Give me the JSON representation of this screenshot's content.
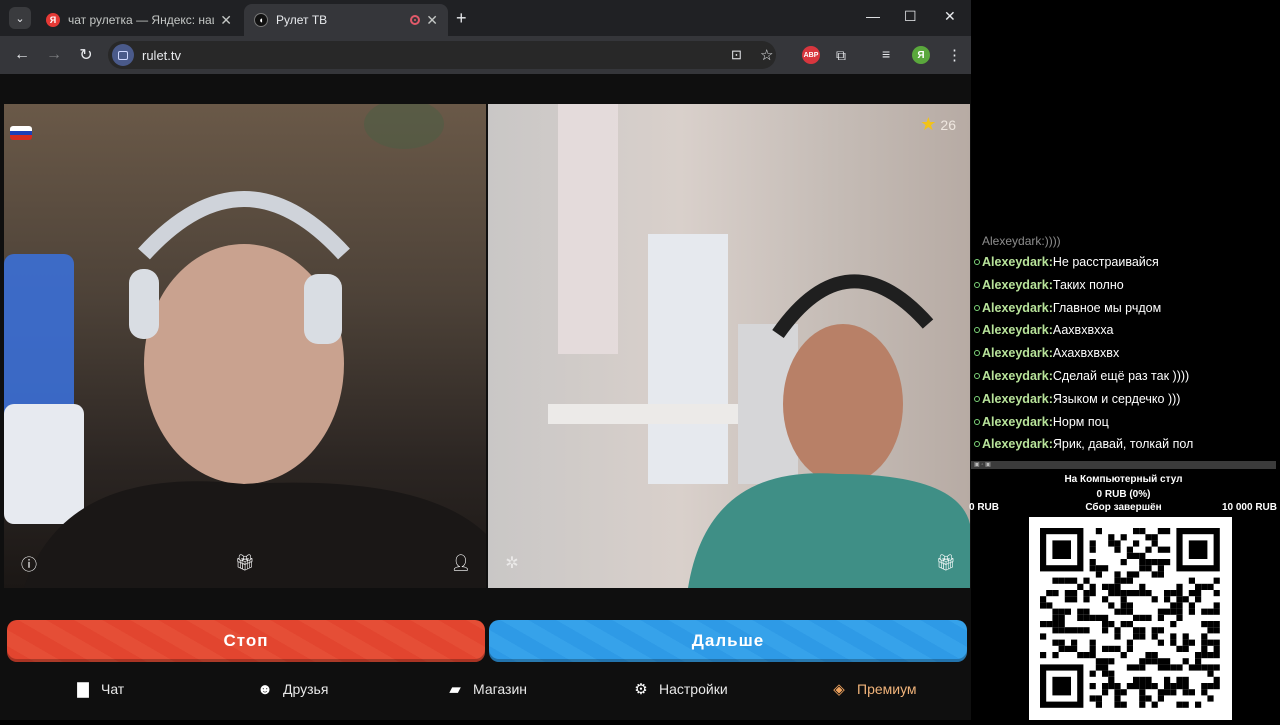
{
  "browser": {
    "tab_menu_icon": "chevron-down-icon",
    "tabs": [
      {
        "title": "чат рулетка — Яндекс: нашлось",
        "favicon": "yandex-icon",
        "favicon_letter": "Я",
        "favicon_color": "#e53935",
        "close": "✕"
      },
      {
        "title": "Рулет ТВ",
        "favicon": "rulet-icon",
        "favicon_color": "#111111",
        "close": "✕",
        "active": true
      }
    ],
    "new_tab": "+",
    "window_controls": {
      "minimize": "—",
      "maximize": "☐",
      "close": "✕"
    },
    "url": "rulet.tv",
    "nav": {
      "back": "←",
      "forward": "→",
      "reload": "↻"
    },
    "toolbar_icons": {
      "install": "⊡",
      "bookmark": "☆",
      "abp": "ABP",
      "extensions": "⧉",
      "media": "≡",
      "profile": "Я",
      "menu": "⋮"
    }
  },
  "video": {
    "stars_count": "26",
    "flag_colors": [
      "#ffffff",
      "#1c3fb8",
      "#d52b1e"
    ]
  },
  "buttons": {
    "stop_label": "Стоп",
    "next_label": "Дальше"
  },
  "bottom_nav": [
    {
      "label": "Чат",
      "icon": "chat-icon"
    },
    {
      "label": "Друзья",
      "icon": "friends-icon"
    },
    {
      "label": "Магазин",
      "icon": "shop-icon"
    },
    {
      "label": "Настройки",
      "icon": "settings-icon"
    },
    {
      "label": "Премиум",
      "icon": "premium-icon"
    }
  ],
  "stream_chat": {
    "cut_line": "Alexeydark:))))",
    "messages": [
      {
        "user": "Alexeydark:",
        "text": "Не расстраивайся"
      },
      {
        "user": "Alexeydark:",
        "text": "Таких полно"
      },
      {
        "user": "Alexeydark:",
        "text": "Главное мы рчдом"
      },
      {
        "user": "Alexeydark:",
        "text": "Аахвхвхха"
      },
      {
        "user": "Alexeydark:",
        "text": "Ахахвхвхвх"
      },
      {
        "user": "Alexeydark:",
        "text": "Сделай ещё раз так ))))"
      },
      {
        "user": "Alexeydark:",
        "text": "Языком и сердечко )))"
      },
      {
        "user": "Alexeydark:",
        "text": "Норм поц"
      },
      {
        "user": "Alexeydark:",
        "text": "Ярик, давай, толкай пол"
      }
    ]
  },
  "donation_goal": {
    "title": "На Компьютерный стул",
    "progress": "0 RUB (0%)",
    "progress_fraction": 0,
    "min": "0 RUB",
    "status": "Сбор завершён",
    "max": "10 000 RUB"
  }
}
